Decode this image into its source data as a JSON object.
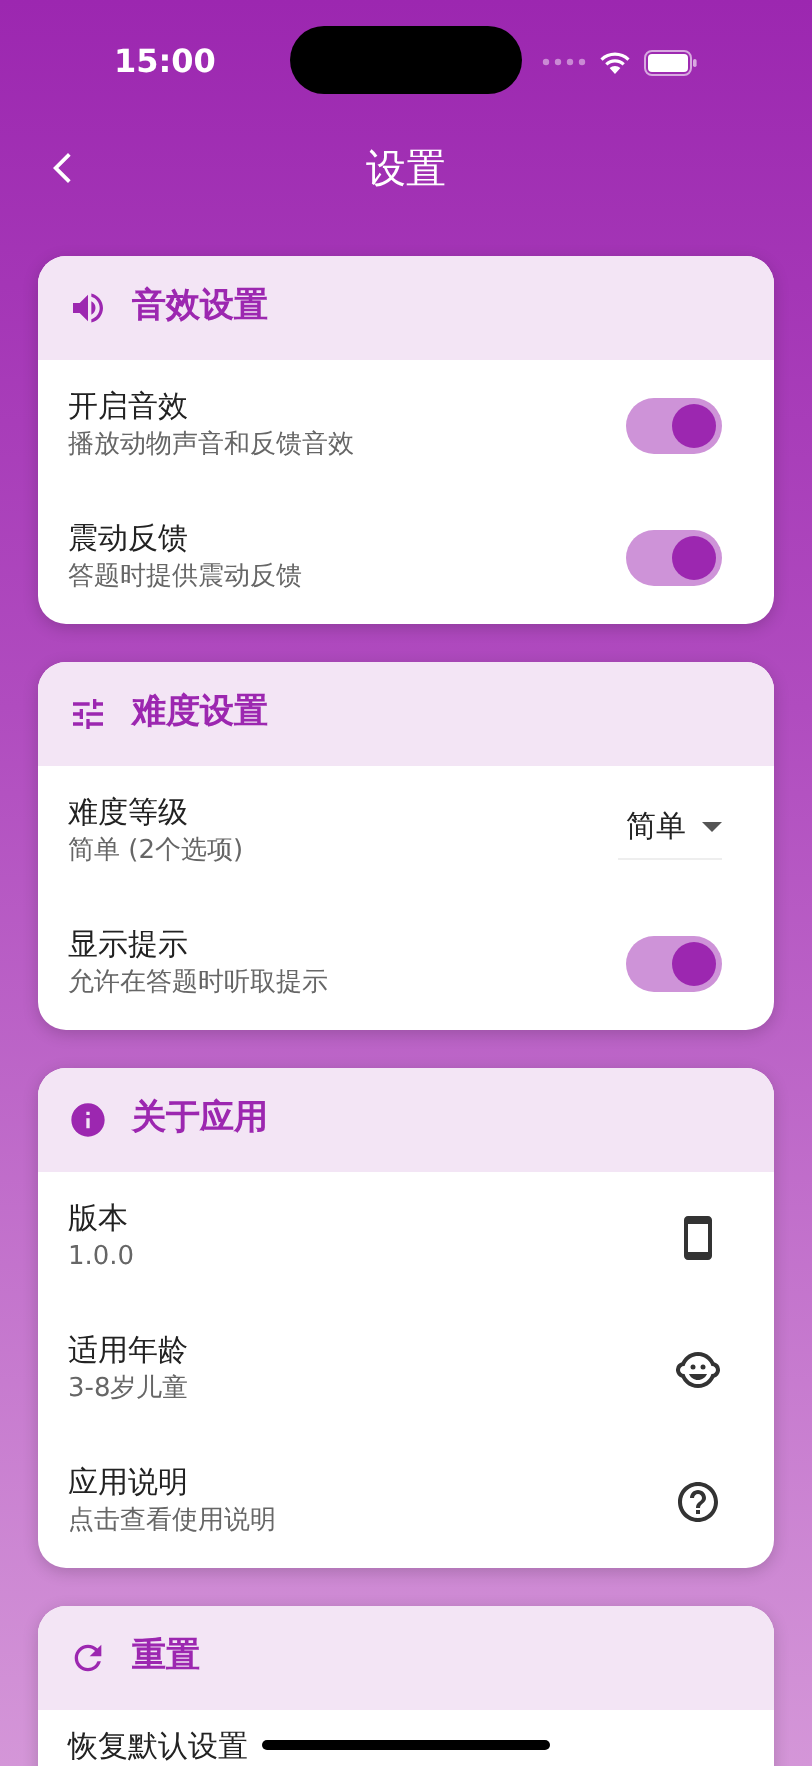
{
  "status_bar": {
    "time": "15:00"
  },
  "header": {
    "title": "设置"
  },
  "sections": [
    {
      "title": "音效设置",
      "rows": [
        {
          "kind": "toggle",
          "title": "开启音效",
          "subtitle": "播放动物声音和反馈音效",
          "on": true
        },
        {
          "kind": "toggle",
          "title": "震动反馈",
          "subtitle": "答题时提供震动反馈",
          "on": true
        }
      ]
    },
    {
      "title": "难度设置",
      "rows": [
        {
          "kind": "dropdown",
          "title": "难度等级",
          "subtitle": "简单 (2个选项)",
          "value": "简单"
        },
        {
          "kind": "toggle",
          "title": "显示提示",
          "subtitle": "允许在答题时听取提示",
          "on": true
        }
      ]
    },
    {
      "title": "关于应用",
      "rows": [
        {
          "kind": "icon",
          "title": "版本",
          "subtitle": "1.0.0"
        },
        {
          "kind": "icon",
          "title": "适用年龄",
          "subtitle": "3-8岁儿童"
        },
        {
          "kind": "icon",
          "title": "应用说明",
          "subtitle": "点击查看使用说明"
        }
      ]
    },
    {
      "title": "重置",
      "rows": [
        {
          "kind": "plain",
          "title": "恢复默认设置"
        }
      ]
    }
  ]
}
